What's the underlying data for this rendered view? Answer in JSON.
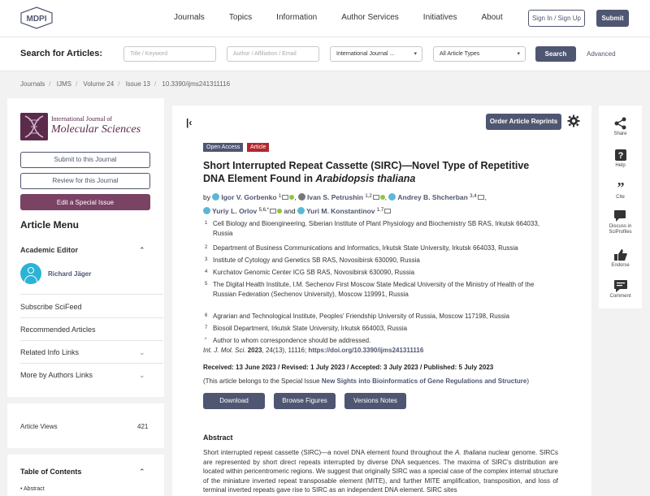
{
  "header": {
    "logo": "MDPI",
    "nav": [
      "Journals",
      "Topics",
      "Information",
      "Author Services",
      "Initiatives",
      "About"
    ],
    "signin_label": "Sign In / Sign Up",
    "submit_label": "Submit"
  },
  "search": {
    "label": "Search for Articles:",
    "title_placeholder": "Title / Keyword",
    "author_placeholder": "Author / Affiliation / Email",
    "journal_select": "International Journal ...",
    "type_select": "All Article Types",
    "search_button": "Search",
    "advanced": "Advanced"
  },
  "breadcrumb": [
    "Journals",
    "IJMS",
    "Volume 24",
    "Issue 13",
    "10.3390/ijms241311116"
  ],
  "sidebar": {
    "journal_line1": "International Journal of",
    "journal_line2": "Molecular Sciences",
    "submit_btn": "Submit to this Journal",
    "review_btn": "Review for this Journal",
    "edit_btn": "Edit a Special Issue",
    "menu_title": "Article Menu",
    "academic_editor": "Academic Editor",
    "editor_name": "Richard Jäger",
    "items": [
      "Subscribe SciFeed",
      "Recommended Articles",
      "Related Info Links",
      "More by Authors Links"
    ],
    "views_label": "Article Views",
    "views_count": "421",
    "toc_title": "Table of Contents",
    "toc_first": "Abstract"
  },
  "article": {
    "reprints_btn": "Order Article Reprints",
    "badge_oa": "Open Access",
    "badge_type": "Article",
    "title_main": "Short Interrupted Repeat Cassette (SIRC)—Novel Type of Repetitive DNA Element Found in ",
    "title_species": "Arabidopsis thaliana",
    "authors": [
      {
        "name": "Igor V. Gorbenko",
        "sup": "1"
      },
      {
        "name": "Ivan S. Petrushin",
        "sup": "1,2"
      },
      {
        "name": "Andrey B. Shcherban",
        "sup": "3,4"
      },
      {
        "name": "Yuriy L. Orlov",
        "sup": "5,6,*"
      },
      {
        "name": "Yuri M. Konstantinov",
        "sup": "1,7"
      }
    ],
    "by": "by",
    "and": "and",
    "affiliations": [
      {
        "n": "1",
        "t": "Cell Biology and Bioengineering, Siberian Institute of Plant Physiology and Biochemistry SB RAS, Irkutsk 664033, Russia"
      },
      {
        "n": "2",
        "t": "Department of Business Communications and Informatics, Irkutsk State University, Irkutsk 664033, Russia"
      },
      {
        "n": "3",
        "t": "Institute of Cytology and Genetics SB RAS, Novosibirsk 630090, Russia"
      },
      {
        "n": "4",
        "t": "Kurchatov Genomic Center ICG SB RAS, Novosibirsk 630090, Russia"
      },
      {
        "n": "5",
        "t": "The Digital Health Institute, I.M. Sechenov First Moscow State Medical University of the Ministry of Health of the Russian Federation (Sechenov University), Moscow 119991, Russia"
      },
      {
        "n": "6",
        "t": "Agrarian and Technological Institute, Peoples' Friendship University of Russia, Moscow 117198, Russia"
      },
      {
        "n": "7",
        "t": "Biosoil Department, Irkutsk State University, Irkutsk 664003, Russia"
      },
      {
        "n": "*",
        "t": "Author to whom correspondence should be addressed."
      }
    ],
    "citation_journal": "Int. J. Mol. Sci.",
    "citation_year": "2023",
    "citation_rest": ", 24(13), 11116; ",
    "doi": "https://doi.org/10.3390/ijms241311116",
    "dates": "Received: 13 June 2023 / Revised: 1 July 2023 / Accepted: 3 July 2023 / Published: 5 July 2023",
    "special_prefix": "(This article belongs to the Special Issue ",
    "special_name": "New Sights into Bioinformatics of Gene Regulations and Structure",
    "special_suffix": ")",
    "btn_download": "Download",
    "btn_figures": "Browse Figures",
    "btn_versions": "Versions Notes",
    "abstract_heading": "Abstract",
    "abstract_pre": "Short interrupted repeat cassette (SIRC)—a novel DNA element found throughout the ",
    "abstract_species": "A. thaliana",
    "abstract_post": " nuclear genome. SIRCs are represented by short direct repeats interrupted by diverse DNA sequences. The maxima of SIRC's distribution are located within pericentromeric regions. We suggest that originally SIRC was a special case of the complex internal structure of the miniature inverted repeat transposable element (MITE), and further MITE amplification, transposition, and loss of terminal inverted repeats gave rise to SIRC as an independent DNA element. SIRC sites"
  },
  "rail": [
    "Share",
    "Help",
    "Cite",
    "Discuss in SciProfiles",
    "Endorse",
    "Comment"
  ]
}
